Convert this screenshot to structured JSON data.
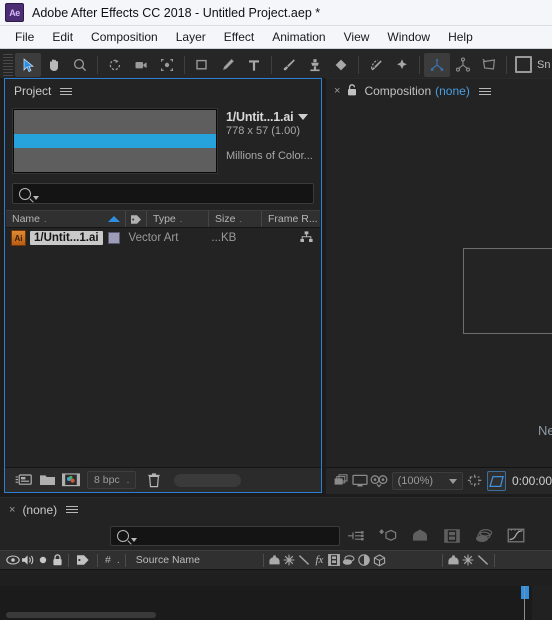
{
  "window": {
    "logo": "ae-logo",
    "title": "Adobe After Effects CC 2018 - Untitled Project.aep *"
  },
  "menubar": {
    "items": [
      {
        "label": "File"
      },
      {
        "label": "Edit"
      },
      {
        "label": "Composition"
      },
      {
        "label": "Layer"
      },
      {
        "label": "Effect"
      },
      {
        "label": "Animation"
      },
      {
        "label": "View"
      },
      {
        "label": "Window"
      },
      {
        "label": "Help"
      }
    ]
  },
  "toolbar": {
    "tools": [
      {
        "name": "selection-tool",
        "active": true
      },
      {
        "name": "hand-tool",
        "active": false
      },
      {
        "name": "zoom-tool",
        "active": false
      },
      {
        "name": "rotation-tool",
        "active": false
      },
      {
        "name": "camera-tool",
        "active": false
      },
      {
        "name": "pan-behind-tool",
        "active": false
      },
      {
        "name": "shape-tool",
        "active": false
      },
      {
        "name": "pen-tool",
        "active": false
      },
      {
        "name": "type-tool",
        "active": false
      },
      {
        "name": "brush-tool",
        "active": false
      },
      {
        "name": "clone-stamp-tool",
        "active": false
      },
      {
        "name": "eraser-tool",
        "active": false
      },
      {
        "name": "roto-brush-tool",
        "active": false
      },
      {
        "name": "puppet-pin-tool",
        "active": false
      },
      {
        "name": "unified-camera-tool",
        "active": true
      },
      {
        "name": "orbit-camera-tool",
        "active": false
      },
      {
        "name": "track-camera-tool",
        "active": false
      }
    ],
    "snapping_label": "Sn"
  },
  "project_panel": {
    "tab_label": "Project",
    "menu_icon": "panel-menu-icon",
    "preview": {
      "thumbnail_icon": "asset-thumbnail",
      "name": "1/Untit...1.ai",
      "dimensions": "778 x 57 (1.00)",
      "color_depth": "Millions of Color..."
    },
    "search": {
      "placeholder": "",
      "value": "",
      "icon": "search-icon"
    },
    "columns": [
      {
        "label": "Name",
        "dot": "."
      },
      {
        "label": "",
        "dot": ""
      },
      {
        "label": "Type",
        "dot": "."
      },
      {
        "label": "Size",
        "dot": "."
      },
      {
        "label": "Frame R...",
        "dot": ""
      }
    ],
    "rows": [
      {
        "icon": "illustrator-file-icon",
        "name": "1/Untit...1.ai",
        "type": "Vector Art",
        "size": "...KB",
        "selected": true
      }
    ],
    "footer": {
      "project_settings_icon": "project-settings-icon",
      "new_folder_icon": "new-folder-icon",
      "new_composition_icon": "new-composition-icon",
      "bit_depth": "8 bpc",
      "bit_depth_dot": ".",
      "delete_icon": "trash-icon",
      "memory_bar": "memory-indicator"
    }
  },
  "composition_panel": {
    "close_icon": "close-icon",
    "lock_icon": "lock-icon",
    "title": "Composition",
    "comp_name": "(none)",
    "menu_icon": "panel-menu-icon",
    "empty_text": "Ne",
    "footer": {
      "layers_icon": "toggle-view-layouts-icon",
      "monitor_icon": "preview-monitor-icon",
      "3d_glasses_icon": "3d-view-icon",
      "zoom_level": "(100%)",
      "roi_icon": "region-of-interest-icon",
      "transparency_grid_icon": "transparency-grid-icon",
      "timecode": "0:00:00"
    }
  },
  "timeline_panel": {
    "close_icon": "close-icon",
    "tab_label": "(none)",
    "menu_icon": "panel-menu-icon",
    "search": {
      "placeholder": "",
      "value": "",
      "icon": "search-icon"
    },
    "toolbar_icons": [
      {
        "name": "composition-mini-flowchart-icon"
      },
      {
        "name": "draft-3d-icon"
      },
      {
        "name": "hide-shy-layers-icon"
      },
      {
        "name": "frame-blending-icon"
      },
      {
        "name": "motion-blur-icon"
      },
      {
        "name": "graph-editor-icon"
      }
    ],
    "columns": {
      "video_icon": "video-eye-icon",
      "audio_icon": "audio-speaker-icon",
      "solo_icon": "solo-icon",
      "lock_icon": "lock-icon",
      "label_icon": "label-tag-icon",
      "index_label": "#",
      "index_dot": ".",
      "source_name": "Source Name"
    },
    "switches": [
      {
        "name": "shy-switch-icon"
      },
      {
        "name": "collapse-transformations-icon"
      },
      {
        "name": "quality-sampling-icon"
      },
      {
        "name": "effects-fx-icon"
      },
      {
        "name": "frame-blend-switch-icon"
      },
      {
        "name": "motion-blur-switch-icon"
      },
      {
        "name": "adjustment-layer-icon"
      },
      {
        "name": "3d-layer-icon"
      }
    ],
    "switches_right": [
      {
        "name": "shy-switch-icon"
      },
      {
        "name": "collapse-transformations-icon"
      },
      {
        "name": "quality-sampling-icon"
      }
    ]
  }
}
